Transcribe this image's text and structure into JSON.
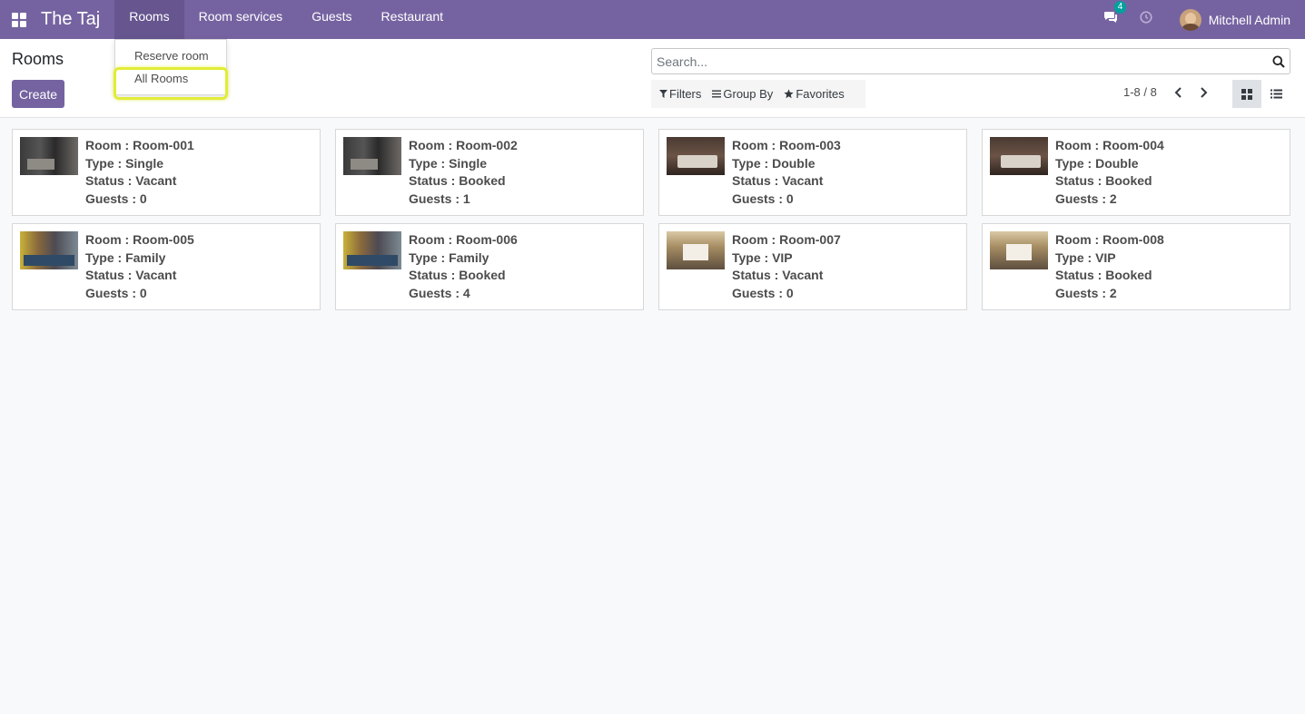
{
  "navbar": {
    "brand": "The Taj",
    "menu": [
      "Rooms",
      "Room services",
      "Guests",
      "Restaurant"
    ],
    "messages_count": "4",
    "user_name": "Mitchell Admin"
  },
  "dropdown": {
    "items": [
      "Reserve room",
      "All Rooms"
    ]
  },
  "control_panel": {
    "title": "Rooms",
    "create_label": "Create",
    "search_placeholder": "Search...",
    "filters_label": "Filters",
    "group_by_label": "Group By",
    "favorites_label": "Favorites",
    "pager": "1-8 / 8"
  },
  "rooms": [
    {
      "room": "Room : Room-001",
      "type": "Type : Single",
      "status": "Status : Vacant",
      "guests": "Guests : 0"
    },
    {
      "room": "Room : Room-002",
      "type": "Type : Single",
      "status": "Status : Booked",
      "guests": "Guests : 1"
    },
    {
      "room": "Room : Room-003",
      "type": "Type : Double",
      "status": "Status : Vacant",
      "guests": "Guests : 0"
    },
    {
      "room": "Room : Room-004",
      "type": "Type : Double",
      "status": "Status : Booked",
      "guests": "Guests : 2"
    },
    {
      "room": "Room : Room-005",
      "type": "Type : Family",
      "status": "Status : Vacant",
      "guests": "Guests : 0"
    },
    {
      "room": "Room : Room-006",
      "type": "Type : Family",
      "status": "Status : Booked",
      "guests": "Guests : 4"
    },
    {
      "room": "Room : Room-007",
      "type": "Type : VIP",
      "status": "Status : Vacant",
      "guests": "Guests : 0"
    },
    {
      "room": "Room : Room-008",
      "type": "Type : VIP",
      "status": "Status : Booked",
      "guests": "Guests : 2"
    }
  ],
  "colors": {
    "brand_purple": "#7563a1",
    "active_menu": "#66558f",
    "highlight": "#e2ec35",
    "badge": "#00a09d"
  }
}
